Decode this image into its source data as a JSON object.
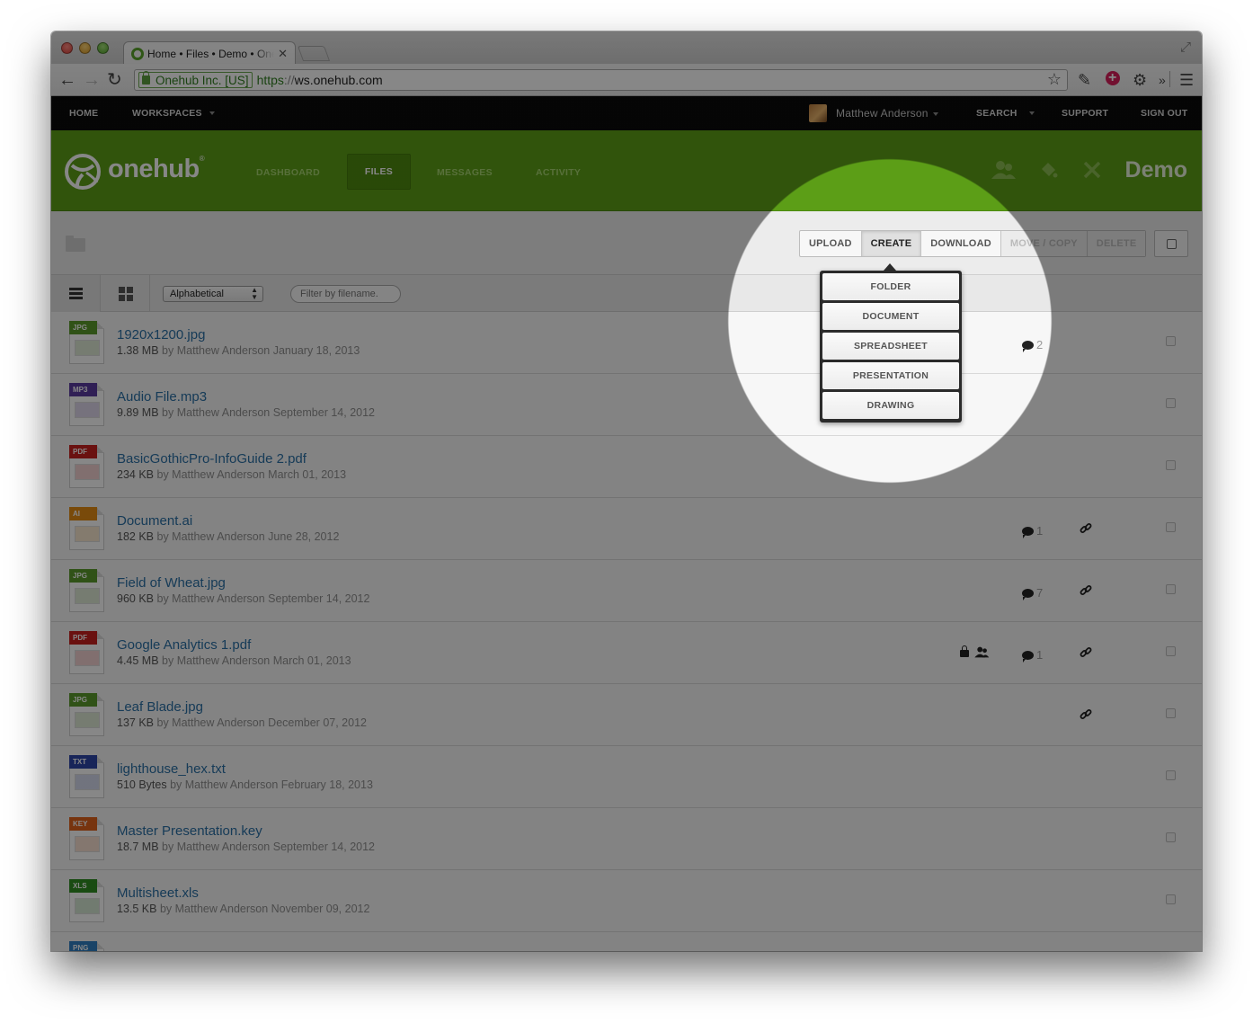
{
  "browser": {
    "tab_title": "Home • Files • Demo • Onehub",
    "tab_close": "✕",
    "ev_cert": "Onehub Inc. [US]",
    "url_scheme": "https",
    "url_sep": "://",
    "url_host": "ws.onehub.com",
    "ext_more": "»"
  },
  "sitebar": {
    "home": "HOME",
    "workspaces": "WORKSPACES",
    "user": "Matthew Anderson",
    "search": "SEARCH",
    "support": "SUPPORT",
    "sign_out": "SIGN OUT"
  },
  "header": {
    "logo": "onehub",
    "logo_mark": "®",
    "nav": {
      "dashboard": "DASHBOARD",
      "files": "FILES",
      "messages": "MESSAGES",
      "activity": "ACTIVITY"
    },
    "workspace": "Demo"
  },
  "actions": {
    "upload": "UPLOAD",
    "create": "CREATE",
    "download": "DOWNLOAD",
    "move_copy": "MOVE / COPY",
    "delete": "DELETE"
  },
  "create_menu": [
    "FOLDER",
    "DOCUMENT",
    "SPREADSHEET",
    "PRESENTATION",
    "DRAWING"
  ],
  "listbar": {
    "sort": "Alphabetical",
    "filter_placeholder": "Filter by filename."
  },
  "files": [
    {
      "name": "1920x1200.jpg",
      "size": "1.38 MB",
      "by": "by Matthew Anderson January 18, 2013",
      "type": "JPG",
      "color": "#5b9a2b",
      "comments": "2",
      "link": false,
      "locked": false
    },
    {
      "name": "Audio File.mp3",
      "size": "9.89 MB",
      "by": "by Matthew Anderson September 14, 2012",
      "type": "MP3",
      "color": "#5a3aa0",
      "comments": "",
      "link": false,
      "locked": false
    },
    {
      "name": "BasicGothicPro-InfoGuide 2.pdf",
      "size": "234 KB",
      "by": "by Matthew Anderson March 01, 2013",
      "type": "PDF",
      "color": "#c8201e",
      "comments": "",
      "link": false,
      "locked": false
    },
    {
      "name": "Document.ai",
      "size": "182 KB",
      "by": "by Matthew Anderson June 28, 2012",
      "type": "AI",
      "color": "#e58b12",
      "comments": "1",
      "link": true,
      "locked": false
    },
    {
      "name": "Field of Wheat.jpg",
      "size": "960 KB",
      "by": "by Matthew Anderson September 14, 2012",
      "type": "JPG",
      "color": "#5b9a2b",
      "comments": "7",
      "link": true,
      "locked": false
    },
    {
      "name": "Google Analytics 1.pdf",
      "size": "4.45 MB",
      "by": "by Matthew Anderson March 01, 2013",
      "type": "PDF",
      "color": "#c8201e",
      "comments": "1",
      "link": true,
      "locked": true
    },
    {
      "name": "Leaf Blade.jpg",
      "size": "137 KB",
      "by": "by Matthew Anderson December 07, 2012",
      "type": "JPG",
      "color": "#5b9a2b",
      "comments": "",
      "link": true,
      "locked": false
    },
    {
      "name": "lighthouse_hex.txt",
      "size": "510 Bytes",
      "by": "by Matthew Anderson February 18, 2013",
      "type": "TXT",
      "color": "#2d45a8",
      "comments": "",
      "link": false,
      "locked": false
    },
    {
      "name": "Master Presentation.key",
      "size": "18.7 MB",
      "by": "by Matthew Anderson September 14, 2012",
      "type": "KEY",
      "color": "#e0621a",
      "comments": "",
      "link": false,
      "locked": false
    },
    {
      "name": "Multisheet.xls",
      "size": "13.5 KB",
      "by": "by Matthew Anderson November 09, 2012",
      "type": "XLS",
      "color": "#2f8d22",
      "comments": "",
      "link": false,
      "locked": false
    },
    {
      "name": "",
      "size": "",
      "by": "",
      "type": "PNG",
      "color": "#2f7fc2",
      "comments": "",
      "link": false,
      "locked": false
    }
  ]
}
